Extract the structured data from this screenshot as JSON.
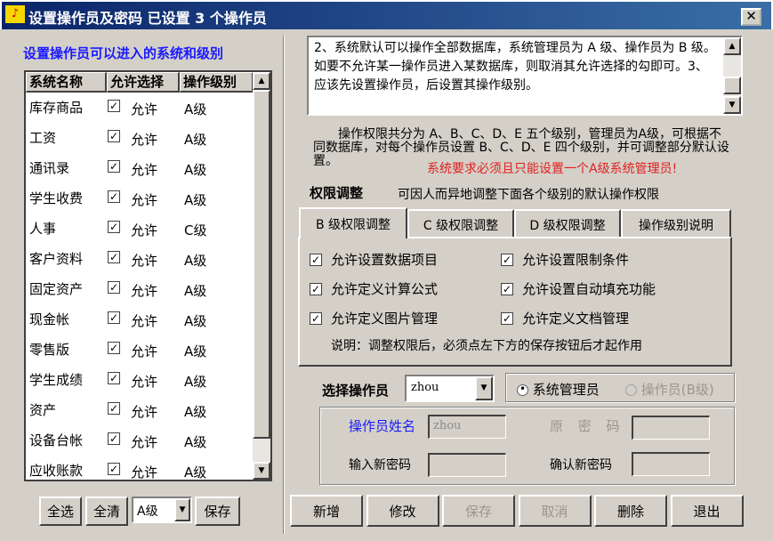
{
  "window": {
    "title": "设置操作员及密码 已设置 3 个操作员",
    "close": "✕"
  },
  "left": {
    "heading": "设置操作员可以进入的系统和级别",
    "columns": [
      "系统名称",
      "允许选择",
      "操作级别"
    ],
    "rows": [
      {
        "name": "库存商品",
        "checked": true,
        "allow": "允许",
        "level": "A级"
      },
      {
        "name": "工资",
        "checked": true,
        "allow": "允许",
        "level": "A级"
      },
      {
        "name": "通讯录",
        "checked": true,
        "allow": "允许",
        "level": "A级"
      },
      {
        "name": "学生收费",
        "checked": true,
        "allow": "允许",
        "level": "A级"
      },
      {
        "name": "人事",
        "checked": true,
        "allow": "允许",
        "level": "C级"
      },
      {
        "name": "客户资料",
        "checked": true,
        "allow": "允许",
        "level": "A级"
      },
      {
        "name": "固定资产",
        "checked": true,
        "allow": "允许",
        "level": "A级"
      },
      {
        "name": "现金帐",
        "checked": true,
        "allow": "允许",
        "level": "A级"
      },
      {
        "name": "零售版",
        "checked": true,
        "allow": "允许",
        "level": "A级"
      },
      {
        "name": "学生成绩",
        "checked": true,
        "allow": "允许",
        "level": "A级"
      },
      {
        "name": "资产",
        "checked": true,
        "allow": "允许",
        "level": "A级"
      },
      {
        "name": "设备台帐",
        "checked": true,
        "allow": "允许",
        "level": "A级"
      },
      {
        "name": "应收账款",
        "checked": true,
        "allow": "允许",
        "level": "A级"
      }
    ],
    "buttons": {
      "select_all": "全选",
      "clear_all": "全清",
      "level_value": "A级",
      "save": "保存"
    }
  },
  "right": {
    "notes": "2、系统默认可以操作全部数据库，系统管理员为 A 级、操作员为 B 级。如要不允许某一操作员进入某数据库，则取消其允许选择的勾即可。3、应该先设置操作员，后设置其操作级别。",
    "intro": "操作权限共分为 A、B、C、D、E 五个级别，管理员为A级，可根据不同数据库，对每个操作员设置 B、C、D、E 四个级别，并可调整部分默认设置。",
    "warning": "系统要求必须且只能设置一个A级系统管理员!",
    "perm_title": "权限调整",
    "perm_desc": "可因人而异地调整下面各个级别的默认操作权限",
    "tabs": [
      "B 级权限调整",
      "C 级权限调整",
      "D 级权限调整",
      "操作级别说明"
    ],
    "active_tab": 0,
    "options": [
      {
        "label": "允许设置数据项目",
        "checked": true
      },
      {
        "label": "允许设置限制条件",
        "checked": true
      },
      {
        "label": "允许定义计算公式",
        "checked": true
      },
      {
        "label": "允许设置自动填充功能",
        "checked": true
      },
      {
        "label": "允许定义图片管理",
        "checked": true
      },
      {
        "label": "允许定义文档管理",
        "checked": true
      }
    ],
    "note": "说明：调整权限后，必须点左下方的保存按钮后才起作用",
    "select_operator_label": "选择操作员",
    "operator": "zhou",
    "radio_admin": "系统管理员",
    "radio_operator": "操作员(B级)",
    "selected_role": "系统管理员",
    "name_label": "操作员姓名",
    "name_value": "zhou",
    "old_pwd_label": "原 密 码",
    "new_pwd_label": "输入新密码",
    "confirm_pwd_label": "确认新密码",
    "buttons": [
      "新增",
      "修改",
      "保存",
      "取消",
      "删除",
      "退出"
    ],
    "accent_blue": "#1a1aff",
    "warning_red": "#e02020"
  }
}
